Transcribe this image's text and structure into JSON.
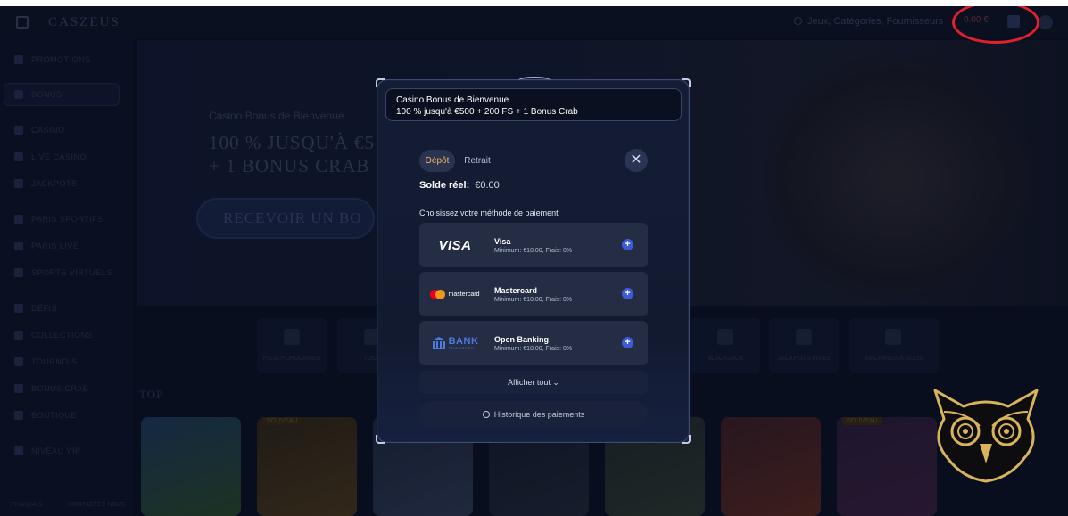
{
  "header": {
    "logo_text": "CASZEUS",
    "search_placeholder": "Jeux, Catégories, Fournisseurs",
    "balance": "0.00 €"
  },
  "sidebar": {
    "items": [
      {
        "label": "PROMOTIONS"
      },
      {
        "label": "BONUS"
      },
      {
        "label": "CASINO"
      },
      {
        "label": "LIVE CASINO"
      },
      {
        "label": "JACKPOTS"
      },
      {
        "label": "PARIS SPORTIFS"
      },
      {
        "label": "PARIS LIVE"
      },
      {
        "label": "SPORTS VIRTUELS"
      },
      {
        "label": "DÉFIS"
      },
      {
        "label": "COLLECTIONS"
      },
      {
        "label": "TOURNOIS"
      },
      {
        "label": "BONUS CRAB"
      },
      {
        "label": "BOUTIQUE"
      },
      {
        "label": "NIVEAU VIP"
      }
    ],
    "footer_left": "FRANÇAIS",
    "footer_right": "CONTACTEZ-NOUS"
  },
  "hero": {
    "subtitle": "Casino Bonus de Bienvenue",
    "title_line1": "100 % JUSQU'À €5",
    "title_line2": "+ 1 BONUS CRAB",
    "cta": "RECEVOIR UN BO"
  },
  "categories": [
    {
      "label": "PLUS POPULAIRES"
    },
    {
      "label": "TOUS"
    },
    {
      "label": "BLACKJACK"
    },
    {
      "label": "JACKPOTS FIXES"
    },
    {
      "label": "MACHINES À SOUS"
    }
  ],
  "top_section": {
    "label": "TOP"
  },
  "games": [
    {
      "badge": ""
    },
    {
      "badge": "NOUVEAU"
    },
    {
      "badge": ""
    },
    {
      "badge": ""
    },
    {
      "badge": ""
    },
    {
      "badge": ""
    },
    {
      "badge": "NOUVEAU"
    }
  ],
  "modal": {
    "bonus_title": "Casino Bonus de Bienvenue",
    "bonus_desc": "100 % jusqu'à €500 + 200 FS + 1 Bonus Crab",
    "tab_deposit": "Dépôt",
    "tab_withdraw": "Retrait",
    "close_symbol": "✕",
    "balance_label": "Solde réel:",
    "balance_value": "€0.00",
    "choose_label": "Choisissez votre méthode de paiement",
    "methods": [
      {
        "name": "Visa",
        "info": "Minimum: €10.00, Frais: 0%",
        "logo": "VISA"
      },
      {
        "name": "Mastercard",
        "info": "Minimum: €10.00, Frais: 0%",
        "logo": "mastercard"
      },
      {
        "name": "Open Banking",
        "info": "Minimum: €10.00, Frais: 0%",
        "logo_big": "BANK",
        "logo_small": "TRANSFER"
      }
    ],
    "show_all": "Afficher tout ⌄",
    "history": "Historique des paiements"
  },
  "colors": {
    "accent_gold": "#e8b86a",
    "plus_blue": "#3d5bd9",
    "annotation_red": "#e0202a",
    "owl_gold": "#d9b45a"
  }
}
